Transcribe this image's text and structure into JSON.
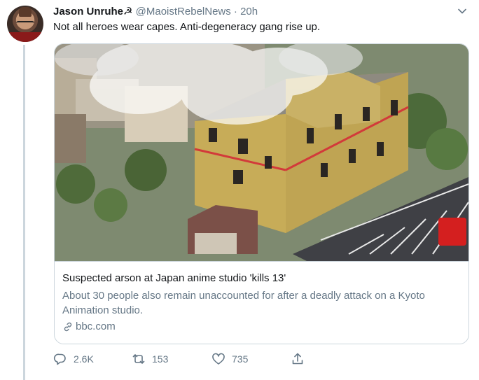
{
  "tweet": {
    "author_name": "Jason Unruhe☭",
    "handle": "@MaoistRebelNews",
    "separator": "·",
    "time": "20h",
    "text": "Not all heroes wear capes. Anti-degeneracy gang rise up."
  },
  "card": {
    "title": "Suspected arson at Japan anime studio 'kills 13'",
    "description": "About 30 people also remain unaccounted for after a deadly attack on a Kyoto Animation studio.",
    "domain": "bbc.com"
  },
  "actions": {
    "reply_count": "2.6K",
    "retweet_count": "153",
    "like_count": "735"
  },
  "icons": {
    "menu": "chevron-down-icon",
    "reply": "reply-icon",
    "retweet": "retweet-icon",
    "like": "heart-icon",
    "share": "share-icon",
    "link": "link-icon"
  },
  "colors": {
    "text_primary": "#14171a",
    "text_secondary": "#657786",
    "border": "#ccd6dd",
    "thread_line": "#ccd6dd"
  }
}
